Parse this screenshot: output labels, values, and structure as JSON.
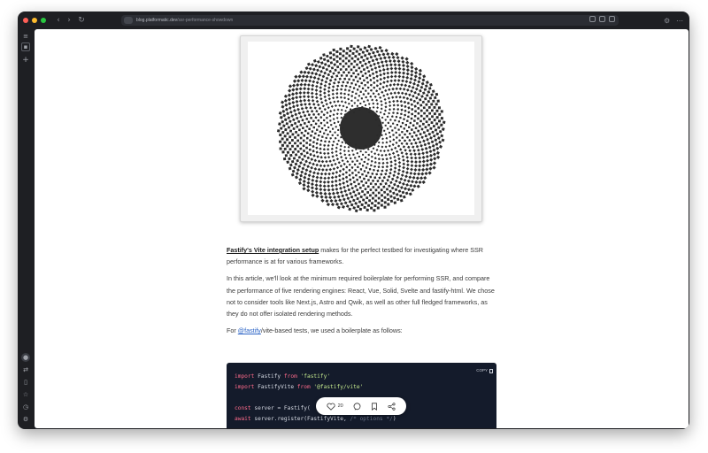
{
  "browser": {
    "url_host": "blog.platformatic.dev",
    "url_path": "/ssr-performance-showdown",
    "traffic_lights": [
      "#ff5f57",
      "#febc2e",
      "#28c840"
    ]
  },
  "article": {
    "p1_link": "Fastify's Vite integration setup",
    "p1_rest": " makes for the perfect testbed for investigating where SSR performance is at for various frameworks.",
    "p2": "In this article, we'll look at the minimum required boilerplate for performing SSR, and compare the performance of five rendering engines: React, Vue, Solid, Svelte and fastify-html. We chose not to consider tools like Next.js, Astro and Qwik, as well as other full fledged frameworks, as they do not offer isolated rendering methods.",
    "p3_prefix": "For ",
    "p3_mention": "@fastify",
    "p3_rest": "/vite-based tests, we used a boilerplate as follows:"
  },
  "code": {
    "copy_label": "COPY",
    "l1_kw": "import",
    "l1_a": " Fastify ",
    "l1_kw2": "from",
    "l1_str": " 'fastify'",
    "l2_kw": "import",
    "l2_a": " FastifyVite ",
    "l2_kw2": "from",
    "l2_str": " '@fastify/vite'",
    "l4_kw": "const",
    "l4_a": " server = Fastify(",
    "l5_kw": "await",
    "l5_a": " server.register(FastifyVite, ",
    "l5_cmt": "/* options */",
    "l5_b": ")"
  },
  "reactions": {
    "likes": "20"
  },
  "colors": {
    "accent_link": "#2a63c6",
    "code_bg": "#141b2b",
    "window_bg": "#1e1f23"
  }
}
